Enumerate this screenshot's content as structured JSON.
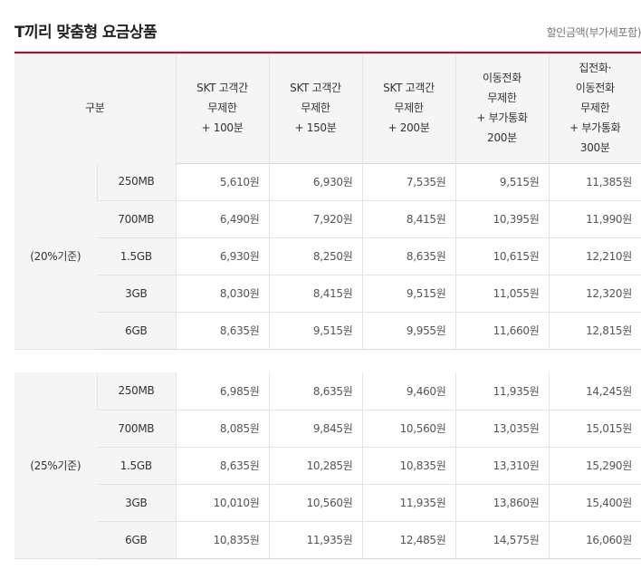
{
  "title": "T끼리 맞춤형 요금상품",
  "note": "할인금액(부가세포함)",
  "header": {
    "category": "구분",
    "plans": [
      [
        "SKT 고객간",
        "무제한",
        "+ 100분"
      ],
      [
        "SKT 고객간",
        "무제한",
        "+ 150분"
      ],
      [
        "SKT 고객간",
        "무제한",
        "+ 200분"
      ],
      [
        "이동전화",
        "무제한",
        "+ 부가통화",
        "200분"
      ],
      [
        "집전화·",
        "이동전화",
        "무제한",
        "+ 부가통화",
        "300분"
      ]
    ]
  },
  "blocks": [
    {
      "label": "(20%기준)",
      "rows": [
        {
          "cap": "250MB",
          "prices": [
            "5,610원",
            "6,930원",
            "7,535원",
            "9,515원",
            "11,385원"
          ]
        },
        {
          "cap": "700MB",
          "prices": [
            "6,490원",
            "7,920원",
            "8,415원",
            "10,395원",
            "11,990원"
          ]
        },
        {
          "cap": "1.5GB",
          "prices": [
            "6,930원",
            "8,250원",
            "8,635원",
            "10,615원",
            "12,210원"
          ]
        },
        {
          "cap": "3GB",
          "prices": [
            "8,030원",
            "8,415원",
            "9,515원",
            "11,055원",
            "12,320원"
          ]
        },
        {
          "cap": "6GB",
          "prices": [
            "8,635원",
            "9,515원",
            "9,955원",
            "11,660원",
            "12,815원"
          ]
        }
      ]
    },
    {
      "label": "(25%기준)",
      "rows": [
        {
          "cap": "250MB",
          "prices": [
            "6,985원",
            "8,635원",
            "9,460원",
            "11,935원",
            "14,245원"
          ]
        },
        {
          "cap": "700MB",
          "prices": [
            "8,085원",
            "9,845원",
            "10,560원",
            "13,035원",
            "15,015원"
          ]
        },
        {
          "cap": "1.5GB",
          "prices": [
            "8,635원",
            "10,285원",
            "10,835원",
            "13,310원",
            "15,290원"
          ]
        },
        {
          "cap": "3GB",
          "prices": [
            "10,010원",
            "10,560원",
            "11,935원",
            "13,860원",
            "15,400원"
          ]
        },
        {
          "cap": "6GB",
          "prices": [
            "10,835원",
            "11,935원",
            "12,485원",
            "14,575원",
            "16,060원"
          ]
        }
      ]
    }
  ]
}
